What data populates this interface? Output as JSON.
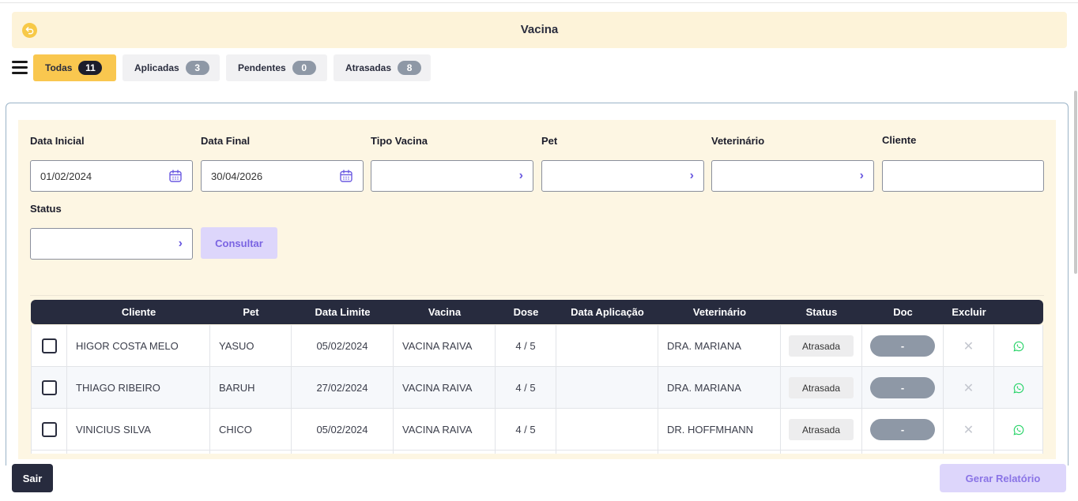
{
  "header": {
    "title": "Vacina",
    "back_icon": "undo-arrow-icon"
  },
  "tabs": [
    {
      "label": "Todas",
      "count": "11"
    },
    {
      "label": "Aplicadas",
      "count": "3"
    },
    {
      "label": "Pendentes",
      "count": "0"
    },
    {
      "label": "Atrasadas",
      "count": "8"
    }
  ],
  "filters": {
    "data_inicial": {
      "label": "Data Inicial",
      "value": "01/02/2024"
    },
    "data_final": {
      "label": "Data Final",
      "value": "30/04/2026"
    },
    "tipo_vacina": {
      "label": "Tipo Vacina",
      "value": ""
    },
    "pet": {
      "label": "Pet",
      "value": ""
    },
    "veterinario": {
      "label": "Veterinário",
      "value": ""
    },
    "cliente": {
      "label": "Cliente",
      "value": ""
    },
    "status": {
      "label": "Status",
      "value": ""
    },
    "consultar_label": "Consultar"
  },
  "table": {
    "columns": [
      "Cliente",
      "Pet",
      "Data Limite",
      "Vacina",
      "Dose",
      "Data Aplicação",
      "Veterinário",
      "Status",
      "Doc",
      "Excluir"
    ],
    "rows": [
      {
        "cliente": "HIGOR COSTA MELO",
        "pet": "YASUO",
        "data_limite": "05/02/2024",
        "vacina": "VACINA RAIVA",
        "dose": "4 / 5",
        "data_aplicacao": "",
        "veterinario": "DRA. MARIANA",
        "status": "Atrasada",
        "doc": "-"
      },
      {
        "cliente": "THIAGO RIBEIRO",
        "pet": "BARUH",
        "data_limite": "27/02/2024",
        "vacina": "VACINA RAIVA",
        "dose": "4 / 5",
        "data_aplicacao": "",
        "veterinario": "DRA. MARIANA",
        "status": "Atrasada",
        "doc": "-"
      },
      {
        "cliente": "VINICIUS SILVA",
        "pet": "CHICO",
        "data_limite": "05/02/2024",
        "vacina": "VACINA RAIVA",
        "dose": "4 / 5",
        "data_aplicacao": "",
        "veterinario": "DR. HOFFMHANN",
        "status": "Atrasada",
        "doc": "-"
      }
    ]
  },
  "footer": {
    "sair_label": "Sair",
    "gerar_label": "Gerar Relatório"
  },
  "colors": {
    "accent": "#f9c74f",
    "dark": "#272b3e",
    "purple": "#7a64e2",
    "whatsapp": "#25d366"
  }
}
